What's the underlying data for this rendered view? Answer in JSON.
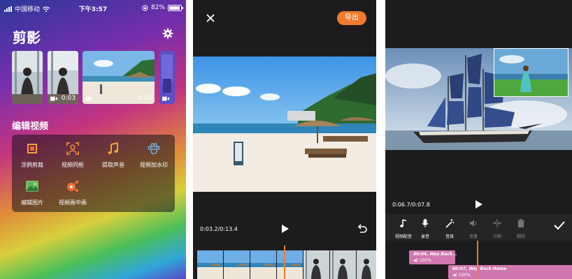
{
  "status": {
    "carrier": "中国移动",
    "time": "下午3:57",
    "battery": "82%"
  },
  "home": {
    "title": "剪影",
    "thumbnails": [
      {
        "duration": ""
      },
      {
        "duration": "0:03"
      },
      {
        "duration": "0:03"
      },
      {
        "duration": ""
      }
    ],
    "section_title": "编辑视频",
    "tools": [
      {
        "label": "涂鸦剪裁",
        "icon": "crop-icon"
      },
      {
        "label": "视频同框",
        "icon": "portrait-frame-icon"
      },
      {
        "label": "提取声音",
        "icon": "music-note-icon"
      },
      {
        "label": "视频加水印",
        "icon": "paw-icon"
      },
      {
        "label": "编辑图片",
        "icon": "image-icon"
      },
      {
        "label": "视频画中画",
        "icon": "share-nodes-icon"
      }
    ]
  },
  "player": {
    "export_label": "导出",
    "time": "0:03.2/0:13.4"
  },
  "editor": {
    "time": "0:06.7/0:07.8",
    "tools": [
      {
        "label": "视频配音",
        "icon": "music-note-icon",
        "enabled": true
      },
      {
        "label": "录音",
        "icon": "microphone-icon",
        "enabled": true
      },
      {
        "label": "音效",
        "icon": "magic-wand-icon",
        "enabled": true
      },
      {
        "label": "音量",
        "icon": "speaker-icon",
        "enabled": false
      },
      {
        "label": "分割",
        "icon": "split-icon",
        "enabled": false
      },
      {
        "label": "删除",
        "icon": "trash-icon",
        "enabled": false
      }
    ],
    "tracks": [
      {
        "title": "00:04, Way Back...",
        "volume": "100%"
      },
      {
        "title": "00:07, Way Back Home",
        "volume": "100%"
      }
    ]
  },
  "colors": {
    "accent": "#f07a2e",
    "dark_bg": "#1c1c1e",
    "track": "#d177b0"
  }
}
